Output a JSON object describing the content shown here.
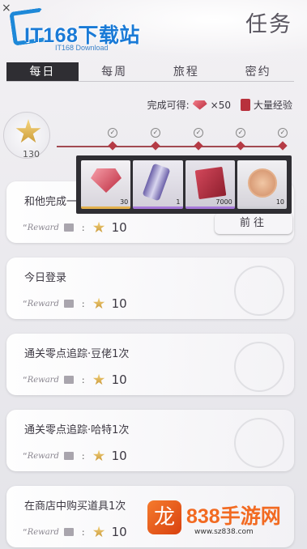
{
  "logo": {
    "text": "IT168下载站",
    "sub": "IT168 Download"
  },
  "header": {
    "close_glyph": "×",
    "title": "任务"
  },
  "tabs": [
    {
      "label": "每日",
      "active": true
    },
    {
      "label": "每周",
      "active": false
    },
    {
      "label": "旅程",
      "active": false
    },
    {
      "label": "密约",
      "active": false
    }
  ],
  "completion": {
    "label": "完成可得:",
    "gem_amount": "×50",
    "exp_label": "大量经验"
  },
  "stars": {
    "count": "130"
  },
  "popup_items": [
    {
      "qty": "30",
      "icon": "gem-icon"
    },
    {
      "qty": "1",
      "icon": "drink-can-icon"
    },
    {
      "qty": "7000",
      "icon": "exp-book-icon"
    },
    {
      "qty": "10",
      "icon": "coin-icon"
    }
  ],
  "tasks": [
    {
      "title": "和他完成一",
      "reward_prefix": "“",
      "reward_word": "Reward",
      "reward_value": "10"
    },
    {
      "title": "今日登录",
      "reward_prefix": "“",
      "reward_word": "Reward",
      "reward_value": "10"
    },
    {
      "title": "通关零点追踪·豆佬1次",
      "reward_prefix": "“",
      "reward_word": "Reward",
      "reward_value": "10"
    },
    {
      "title": "通关零点追踪·哈特1次",
      "reward_prefix": "“",
      "reward_word": "Reward",
      "reward_value": "10"
    },
    {
      "title": "在商店中购买道具1次",
      "reward_prefix": "“",
      "reward_word": "Reward",
      "reward_value": "10"
    }
  ],
  "goto_button": "前往",
  "watermark": {
    "logo_char": "龙",
    "text": "838手游网",
    "url": "www.sz838.com"
  }
}
